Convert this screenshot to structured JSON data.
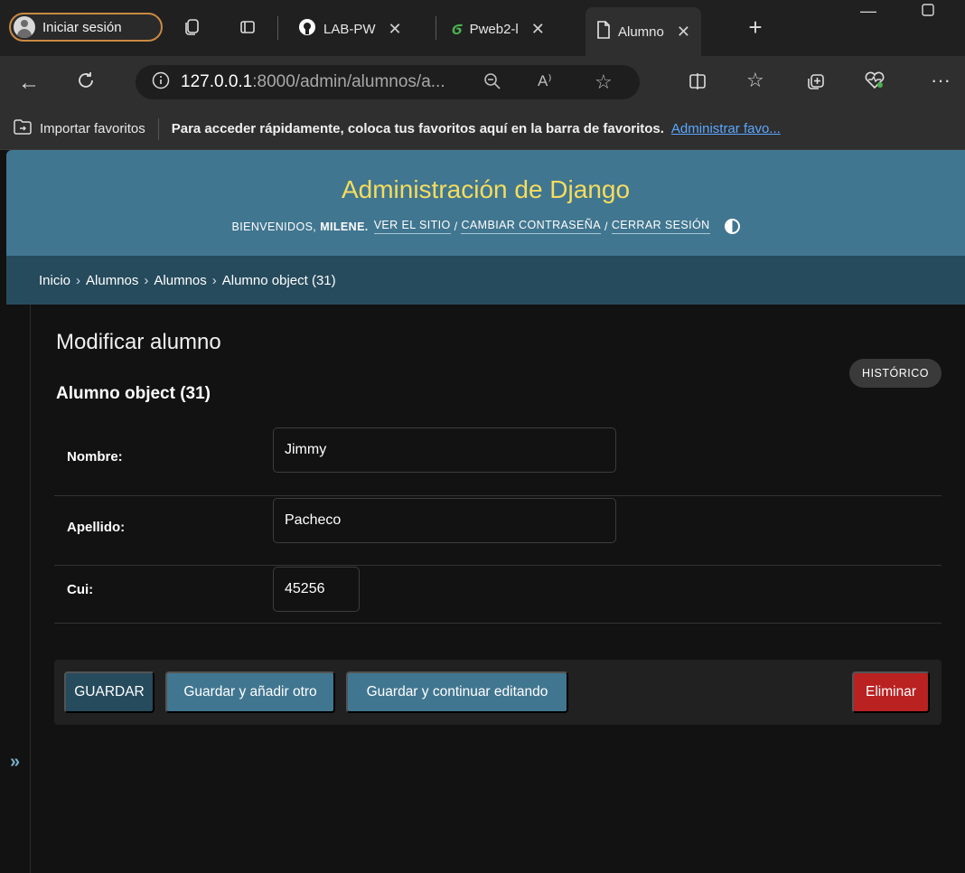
{
  "browser": {
    "profile_label": "Iniciar sesión",
    "tabs": [
      {
        "label": "LAB-PW",
        "icon": "github-icon"
      },
      {
        "label": "Pweb2-l",
        "icon": "leaf-icon"
      },
      {
        "label": "Alumno",
        "icon": "page-icon",
        "active": true
      }
    ],
    "url_host": "127.0.0.1",
    "url_rest": ":8000/admin/alumnos/a...",
    "favorites": {
      "import_label": "Importar favoritos",
      "message": "Para acceder rápidamente, coloca tus favoritos aquí en la barra de favoritos.",
      "manage_link": "Administrar favo..."
    }
  },
  "header": {
    "site_name": "Administración de Django",
    "welcome": "BIENVENIDOS,",
    "username": "MILENE.",
    "view_site": "VER EL SITIO",
    "change_password": "CAMBIAR CONTRASEÑA",
    "logout": "CERRAR SESIÓN",
    "slash": "/"
  },
  "breadcrumbs": {
    "home": "Inicio",
    "app": "Alumnos",
    "model": "Alumnos",
    "object": "Alumno object (31)",
    "sep": "›"
  },
  "sidebar": {
    "toggle_label": "»"
  },
  "main": {
    "title": "Modificar alumno",
    "history_label": "HISTÓRICO",
    "object_title": "Alumno object (31)"
  },
  "form": {
    "nombre_label": "Nombre:",
    "nombre_value": "Jimmy",
    "apellido_label": "Apellido:",
    "apellido_value": "Pacheco",
    "cui_label": "Cui:",
    "cui_value": "45256"
  },
  "actions": {
    "save": "GUARDAR",
    "save_add": "Guardar y añadir otro",
    "save_continue": "Guardar y continuar editando",
    "delete": "Eliminar"
  },
  "colors": {
    "header_bg": "#417690",
    "site_name": "#f5dd5d",
    "breadcrumbs_bg": "#264b5d",
    "delete": "#ba2121"
  }
}
